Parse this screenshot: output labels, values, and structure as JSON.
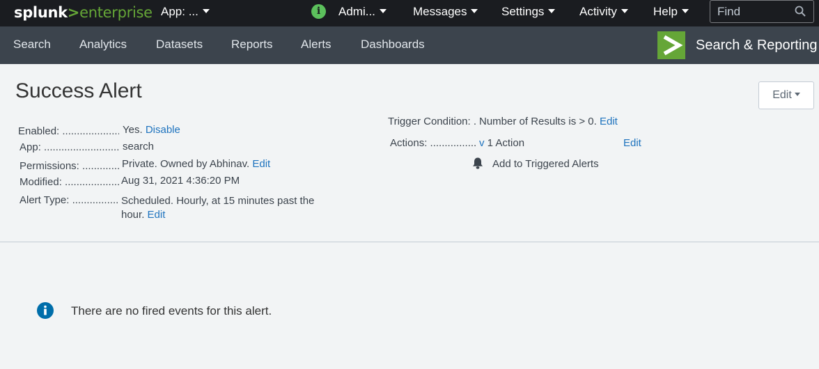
{
  "top": {
    "brand_splunk": "splunk",
    "brand_gt": ">",
    "brand_enterprise": "enterprise",
    "app_menu": "App: ...",
    "admin_menu": "Admi...",
    "messages_menu": "Messages",
    "settings_menu": "Settings",
    "activity_menu": "Activity",
    "help_menu": "Help",
    "find_placeholder": "Find"
  },
  "nav": {
    "items": [
      "Search",
      "Analytics",
      "Datasets",
      "Reports",
      "Alerts",
      "Dashboards"
    ],
    "app_name": "Search & Reporting"
  },
  "alert": {
    "title": "Success Alert",
    "edit_button": "Edit",
    "enabled_label": "Enabled: .....................",
    "enabled_value": "Yes.",
    "disable_link": "Disable",
    "app_label": "App: ...........................",
    "app_value": "search",
    "permissions_label": "Permissions: .............",
    "permissions_value": "Private. Owned by Abhinav.",
    "permissions_edit": "Edit",
    "modified_label": "Modified: .....................",
    "modified_value": "Aug 31, 2021 4:36:20 PM",
    "alert_type_label": "Alert Type: .................",
    "alert_type_value": "Scheduled. Hourly, at 15 minutes past the hour.",
    "alert_type_edit": "Edit",
    "trigger_label": "Trigger Condition: ..",
    "trigger_value": "Number of Results is > 0.",
    "trigger_edit": "Edit",
    "actions_label": "Actions: .................",
    "actions_toggle": "v",
    "actions_value": "1 Action",
    "actions_edit": "Edit",
    "action_item": "Add to Triggered Alerts"
  },
  "events": {
    "empty_message": "There are no fired events for this alert."
  },
  "colors": {
    "brand_green": "#65a637",
    "link_blue": "#1e73be",
    "info_blue": "#006eaa",
    "topbar_bg": "#1a1c20",
    "appbar_bg": "#3c444d"
  },
  "icons": {
    "admin_status": "info-circle-icon",
    "find": "search-icon",
    "action_item": "bell-icon",
    "empty_state": "info-circle-icon"
  }
}
